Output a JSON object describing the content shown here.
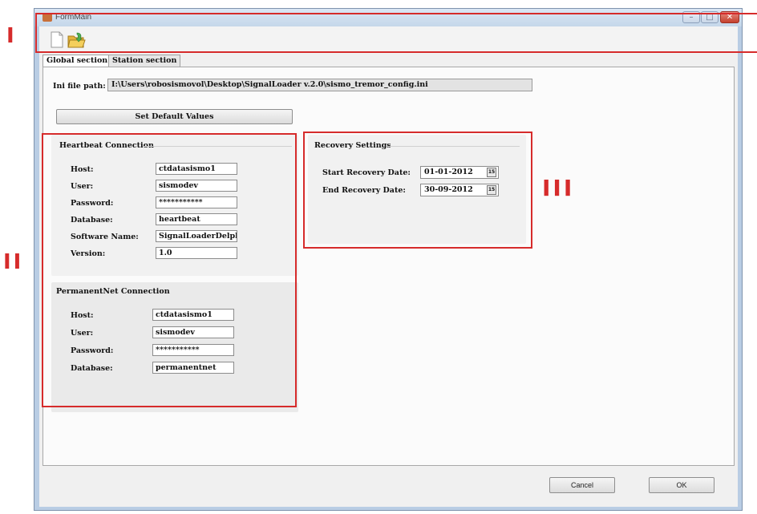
{
  "window": {
    "title": "FormMain",
    "controls": {
      "minimize": "–",
      "maximize": "□",
      "close": "✕"
    }
  },
  "toolbar": {
    "icons": [
      "new-file-icon",
      "open-folder-icon"
    ]
  },
  "tabs": [
    {
      "label": "Global section",
      "active": true
    },
    {
      "label": "Station section",
      "active": false
    }
  ],
  "ini": {
    "label": "Ini file path:",
    "value": "I:\\Users\\robosismovol\\Desktop\\SignalLoader v.2.0\\sismo_tremor_config.ini"
  },
  "default_button": "Set Default Values",
  "heartbeat": {
    "title": "Heartbeat Connection",
    "host_label": "Host:",
    "host": "ctdatasismo1",
    "user_label": "User:",
    "user": "sismodev",
    "password_label": "Password:",
    "password": "***********",
    "database_label": "Database:",
    "database": "heartbeat",
    "software_label": "Software Name:",
    "software": "SignalLoaderDelphi",
    "version_label": "Version:",
    "version": "1.0"
  },
  "permanentnet": {
    "title": "PermanentNet Connection",
    "host_label": "Host:",
    "host": "ctdatasismo1",
    "user_label": "User:",
    "user": "sismodev",
    "password_label": "Password:",
    "password": "***********",
    "database_label": "Database:",
    "database": "permanentnet"
  },
  "recovery": {
    "title": "Recovery Settings",
    "start_label": "Start Recovery Date:",
    "start": "01-01-2012",
    "end_label": "End Recovery Date:",
    "end": "30-09-2012",
    "calendar_glyph": "15"
  },
  "footer": {
    "cancel": "Cancel",
    "ok": "OK"
  },
  "annotations": {
    "i": "I",
    "ii": "II",
    "iii": "III",
    "color": "#d62b2b"
  }
}
